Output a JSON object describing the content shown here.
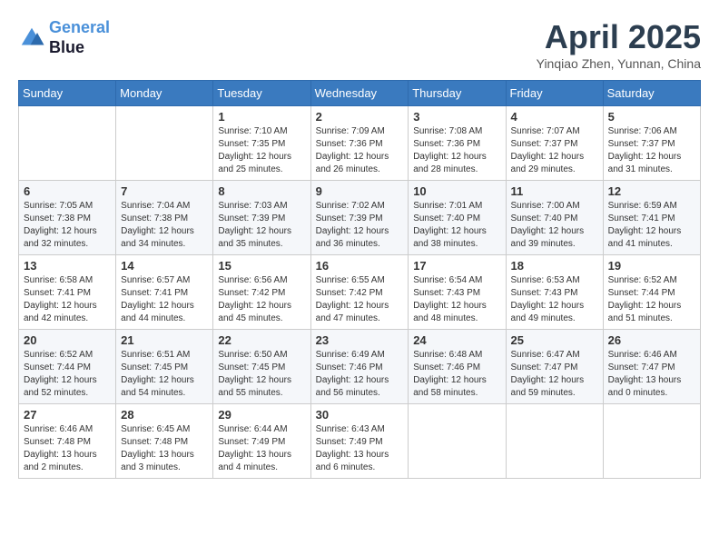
{
  "header": {
    "logo_line1": "General",
    "logo_line2": "Blue",
    "month_title": "April 2025",
    "location": "Yinqiao Zhen, Yunnan, China"
  },
  "weekdays": [
    "Sunday",
    "Monday",
    "Tuesday",
    "Wednesday",
    "Thursday",
    "Friday",
    "Saturday"
  ],
  "weeks": [
    [
      {
        "day": null
      },
      {
        "day": null
      },
      {
        "day": "1",
        "sunrise": "7:10 AM",
        "sunset": "7:35 PM",
        "daylight": "12 hours and 25 minutes."
      },
      {
        "day": "2",
        "sunrise": "7:09 AM",
        "sunset": "7:36 PM",
        "daylight": "12 hours and 26 minutes."
      },
      {
        "day": "3",
        "sunrise": "7:08 AM",
        "sunset": "7:36 PM",
        "daylight": "12 hours and 28 minutes."
      },
      {
        "day": "4",
        "sunrise": "7:07 AM",
        "sunset": "7:37 PM",
        "daylight": "12 hours and 29 minutes."
      },
      {
        "day": "5",
        "sunrise": "7:06 AM",
        "sunset": "7:37 PM",
        "daylight": "12 hours and 31 minutes."
      }
    ],
    [
      {
        "day": "6",
        "sunrise": "7:05 AM",
        "sunset": "7:38 PM",
        "daylight": "12 hours and 32 minutes."
      },
      {
        "day": "7",
        "sunrise": "7:04 AM",
        "sunset": "7:38 PM",
        "daylight": "12 hours and 34 minutes."
      },
      {
        "day": "8",
        "sunrise": "7:03 AM",
        "sunset": "7:39 PM",
        "daylight": "12 hours and 35 minutes."
      },
      {
        "day": "9",
        "sunrise": "7:02 AM",
        "sunset": "7:39 PM",
        "daylight": "12 hours and 36 minutes."
      },
      {
        "day": "10",
        "sunrise": "7:01 AM",
        "sunset": "7:40 PM",
        "daylight": "12 hours and 38 minutes."
      },
      {
        "day": "11",
        "sunrise": "7:00 AM",
        "sunset": "7:40 PM",
        "daylight": "12 hours and 39 minutes."
      },
      {
        "day": "12",
        "sunrise": "6:59 AM",
        "sunset": "7:41 PM",
        "daylight": "12 hours and 41 minutes."
      }
    ],
    [
      {
        "day": "13",
        "sunrise": "6:58 AM",
        "sunset": "7:41 PM",
        "daylight": "12 hours and 42 minutes."
      },
      {
        "day": "14",
        "sunrise": "6:57 AM",
        "sunset": "7:41 PM",
        "daylight": "12 hours and 44 minutes."
      },
      {
        "day": "15",
        "sunrise": "6:56 AM",
        "sunset": "7:42 PM",
        "daylight": "12 hours and 45 minutes."
      },
      {
        "day": "16",
        "sunrise": "6:55 AM",
        "sunset": "7:42 PM",
        "daylight": "12 hours and 47 minutes."
      },
      {
        "day": "17",
        "sunrise": "6:54 AM",
        "sunset": "7:43 PM",
        "daylight": "12 hours and 48 minutes."
      },
      {
        "day": "18",
        "sunrise": "6:53 AM",
        "sunset": "7:43 PM",
        "daylight": "12 hours and 49 minutes."
      },
      {
        "day": "19",
        "sunrise": "6:52 AM",
        "sunset": "7:44 PM",
        "daylight": "12 hours and 51 minutes."
      }
    ],
    [
      {
        "day": "20",
        "sunrise": "6:52 AM",
        "sunset": "7:44 PM",
        "daylight": "12 hours and 52 minutes."
      },
      {
        "day": "21",
        "sunrise": "6:51 AM",
        "sunset": "7:45 PM",
        "daylight": "12 hours and 54 minutes."
      },
      {
        "day": "22",
        "sunrise": "6:50 AM",
        "sunset": "7:45 PM",
        "daylight": "12 hours and 55 minutes."
      },
      {
        "day": "23",
        "sunrise": "6:49 AM",
        "sunset": "7:46 PM",
        "daylight": "12 hours and 56 minutes."
      },
      {
        "day": "24",
        "sunrise": "6:48 AM",
        "sunset": "7:46 PM",
        "daylight": "12 hours and 58 minutes."
      },
      {
        "day": "25",
        "sunrise": "6:47 AM",
        "sunset": "7:47 PM",
        "daylight": "12 hours and 59 minutes."
      },
      {
        "day": "26",
        "sunrise": "6:46 AM",
        "sunset": "7:47 PM",
        "daylight": "13 hours and 0 minutes."
      }
    ],
    [
      {
        "day": "27",
        "sunrise": "6:46 AM",
        "sunset": "7:48 PM",
        "daylight": "13 hours and 2 minutes."
      },
      {
        "day": "28",
        "sunrise": "6:45 AM",
        "sunset": "7:48 PM",
        "daylight": "13 hours and 3 minutes."
      },
      {
        "day": "29",
        "sunrise": "6:44 AM",
        "sunset": "7:49 PM",
        "daylight": "13 hours and 4 minutes."
      },
      {
        "day": "30",
        "sunrise": "6:43 AM",
        "sunset": "7:49 PM",
        "daylight": "13 hours and 6 minutes."
      },
      {
        "day": null
      },
      {
        "day": null
      },
      {
        "day": null
      }
    ]
  ],
  "labels": {
    "sunrise_prefix": "Sunrise: ",
    "sunset_prefix": "Sunset: ",
    "daylight_prefix": "Daylight: "
  }
}
